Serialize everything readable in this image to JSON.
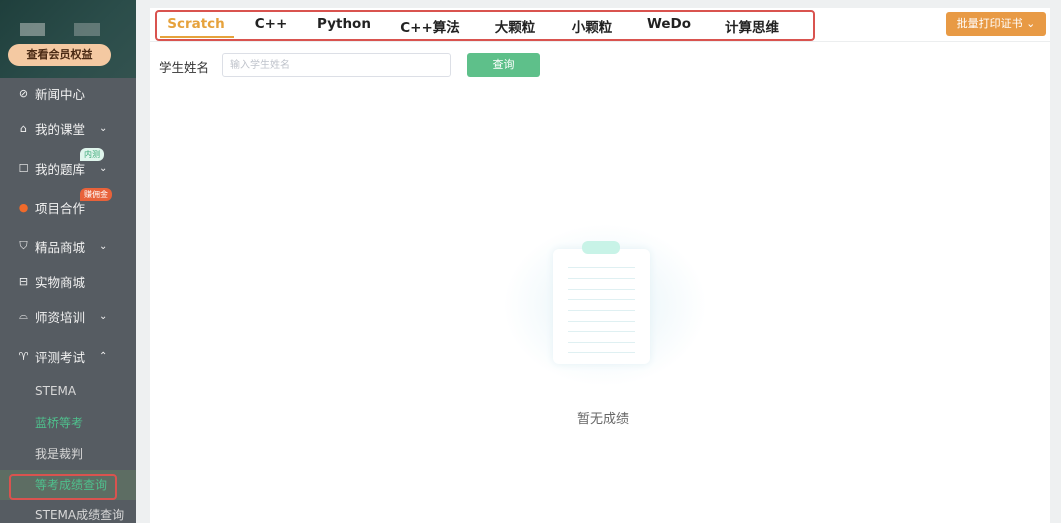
{
  "sidebar": {
    "member_button": "查看会员权益",
    "items": [
      {
        "label": "新闻中心",
        "icon": "compass-icon"
      },
      {
        "label": "我的课堂",
        "icon": "home-icon"
      },
      {
        "label": "我的题库",
        "icon": "question-bank-icon",
        "badge": "内测"
      },
      {
        "label": "项目合作",
        "icon": "fire-icon",
        "badge": "赚佣金"
      },
      {
        "label": "精品商城",
        "icon": "cart-icon"
      },
      {
        "label": "实物商城",
        "icon": "store-icon"
      },
      {
        "label": "师资培训",
        "icon": "graduation-cap-icon"
      },
      {
        "label": "评测考试",
        "icon": "trophy-icon"
      }
    ],
    "sub_items": [
      "STEMA",
      "蓝桥等考",
      "我是裁判",
      "等考成绩查询",
      "STEMA成绩查询"
    ]
  },
  "tabs": [
    "Scratch",
    "C++",
    "Python",
    "C++算法",
    "大颗粒",
    "小颗粒",
    "WeDo",
    "计算思维"
  ],
  "print_button": "批量打印证书",
  "search": {
    "label": "学生姓名",
    "placeholder": "输入学生姓名",
    "value": "",
    "button": "查询"
  },
  "empty_text": "暂无成绩",
  "colors": {
    "accent": "#e6a23c",
    "primary_green": "#5ec08a",
    "highlight_red": "#d9534f"
  }
}
